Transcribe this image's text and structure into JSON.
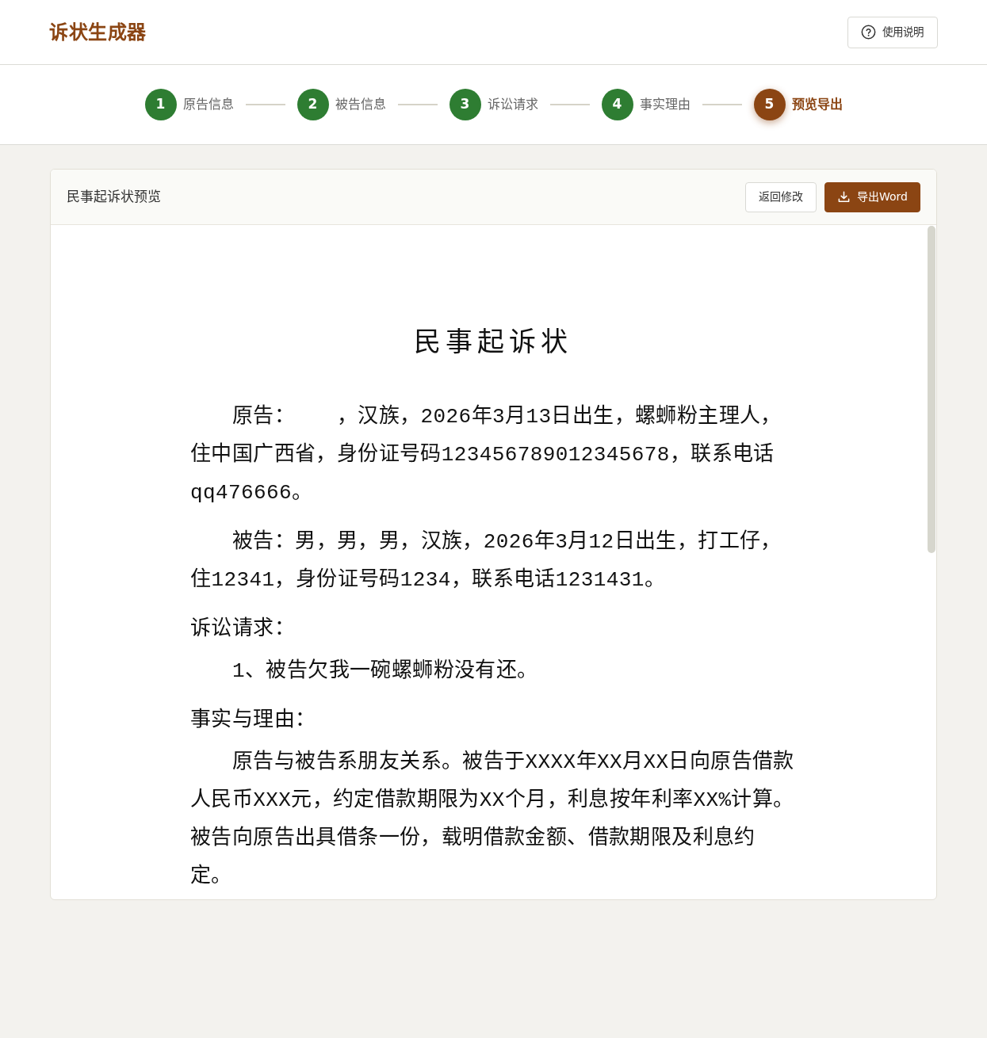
{
  "app": {
    "title": "诉状生成器",
    "help_button": "使用说明"
  },
  "steps": [
    {
      "number": "1",
      "label": "原告信息",
      "completed": true,
      "selected": false
    },
    {
      "number": "2",
      "label": "被告信息",
      "completed": true,
      "selected": false
    },
    {
      "number": "3",
      "label": "诉讼请求",
      "completed": true,
      "selected": false
    },
    {
      "number": "4",
      "label": "事实理由",
      "completed": true,
      "selected": false
    },
    {
      "number": "5",
      "label": "预览导出",
      "completed": false,
      "selected": true
    }
  ],
  "preview": {
    "title": "民事起诉状预览",
    "buttons": [
      {
        "label": "返回修改",
        "kind": "back"
      },
      {
        "label": "导出Word",
        "kind": "export"
      }
    ]
  },
  "document": {
    "title": "民事起诉状",
    "blocks": [
      {
        "kind": "paragraph",
        "text": "原告：　　，汉族，2026年3月13日出生，螺蛳粉主理人，住中国广西省，身份证号码123456789012345678，联系电话qq476666。"
      },
      {
        "kind": "paragraph",
        "text": "被告：男，男，男，汉族，2026年3月12日出生，打工仔，住12341，身份证号码1234，联系电话1231431。"
      },
      {
        "kind": "heading",
        "text": "诉讼请求："
      },
      {
        "kind": "item",
        "text": "1、被告欠我一碗螺蛳粉没有还。"
      },
      {
        "kind": "heading",
        "text": "事实与理由："
      },
      {
        "kind": "paragraph",
        "text": "原告与被告系朋友关系。被告于XXXX年XX月XX日向原告借款人民币XXX元，约定借款期限为XX个月，利息按年利率XX%计算。被告向原告出具借条一份，载明借款金额、借款期限及利息约定。"
      }
    ]
  }
}
